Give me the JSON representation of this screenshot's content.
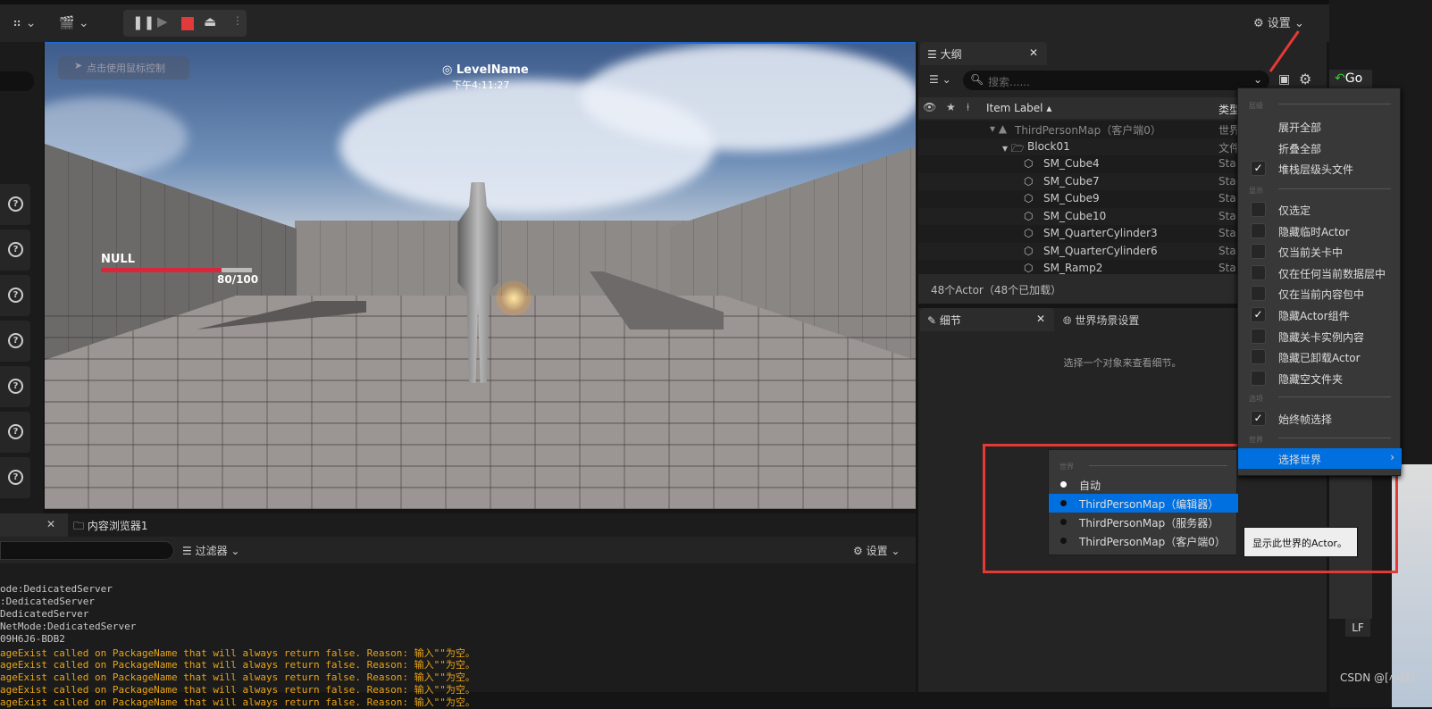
{
  "toolbar": {
    "settings_label": "设置",
    "colors": {
      "stop": "#e03a3a"
    }
  },
  "viewport": {
    "hint": "点击使用鼠标控制",
    "level_name": "LevelName",
    "time": "下午4:11:27",
    "player_name": "NULL",
    "health": "80/100",
    "health_fraction": 0.8
  },
  "outliner": {
    "tab": "大纲",
    "search_placeholder": "搜索......",
    "col_label": "Item Label",
    "col_type": "类型",
    "rows": [
      {
        "label": "ThirdPersonMap（客户端0）",
        "type": "世界"
      },
      {
        "label": "Block01",
        "type": "文件"
      },
      {
        "label": "SM_Cube4",
        "type": "Sta"
      },
      {
        "label": "SM_Cube7",
        "type": "Sta"
      },
      {
        "label": "SM_Cube9",
        "type": "Sta"
      },
      {
        "label": "SM_Cube10",
        "type": "Sta"
      },
      {
        "label": "SM_QuarterCylinder3",
        "type": "Sta"
      },
      {
        "label": "SM_QuarterCylinder6",
        "type": "Sta"
      },
      {
        "label": "SM_Ramp2",
        "type": "Sta"
      }
    ],
    "status": "48个Actor（48个已加载）"
  },
  "details": {
    "tab": "细节",
    "tab2": "世界场景设置",
    "empty": "选择一个对象来查看细节。"
  },
  "menu": {
    "sec_hierarchy": "层级",
    "expand_all": "展开全部",
    "collapse_all": "折叠全部",
    "stack_headers": "堆栈层级头文件",
    "sec_show": "显示",
    "show_items": [
      {
        "label": "仅选定",
        "checked": false
      },
      {
        "label": "隐藏临时Actor",
        "checked": false
      },
      {
        "label": "仅当前关卡中",
        "checked": false
      },
      {
        "label": "仅在任何当前数据层中",
        "checked": false
      },
      {
        "label": "仅在当前内容包中",
        "checked": false
      },
      {
        "label": "隐藏Actor组件",
        "checked": true
      },
      {
        "label": "隐藏关卡实例内容",
        "checked": false
      },
      {
        "label": "隐藏已卸载Actor",
        "checked": false
      },
      {
        "label": "隐藏空文件夹",
        "checked": false
      }
    ],
    "sec_options": "选项",
    "always_frame": "始终帧选择",
    "sec_world": "世界",
    "choose_world": "选择世界",
    "accent": "#0070e0"
  },
  "submenu": {
    "section": "世界",
    "items": [
      {
        "label": "自动",
        "selected": false
      },
      {
        "label": "ThirdPersonMap（编辑器）",
        "selected": true
      },
      {
        "label": "ThirdPersonMap（服务器）",
        "selected": false
      },
      {
        "label": "ThirdPersonMap（客户端0）",
        "selected": false
      }
    ]
  },
  "tooltip": "显示此世界的Actor。",
  "log": {
    "tab2": "内容浏览器1",
    "filter": "过滤器",
    "settings": "设置",
    "lines": [
      {
        "t": "ode:DedicatedServer",
        "warn": false
      },
      {
        "t": ":DedicatedServer",
        "warn": false
      },
      {
        "t": "DedicatedServer",
        "warn": false
      },
      {
        "t": "NetMode:DedicatedServer",
        "warn": false
      },
      {
        "t": "09H6J6-BDB2",
        "warn": false
      },
      {
        "t": "ageExist called on PackageName that will always return false. Reason: 输入\"\"为空。",
        "warn": true
      },
      {
        "t": "ageExist called on PackageName that will always return false. Reason: 输入\"\"为空。",
        "warn": true
      },
      {
        "t": "ageExist called on PackageName that will always return false. Reason: 输入\"\"为空。",
        "warn": true
      },
      {
        "t": "ageExist called on PackageName that will always return false. Reason: 输入\"\"为空。",
        "warn": true
      },
      {
        "t": "ageExist called on PackageName that will always return false. Reason: 输入\"\"为空。",
        "warn": true
      }
    ]
  },
  "right_strip": {
    "go": "Go",
    "lf": "LF"
  },
  "watermark": "CSDN @[小鼠]"
}
